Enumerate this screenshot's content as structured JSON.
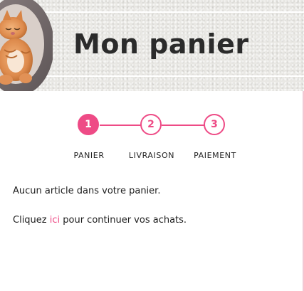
{
  "header": {
    "title": "Mon panier"
  },
  "steps": [
    {
      "number": "1",
      "label": "PANIER",
      "active": true
    },
    {
      "number": "2",
      "label": "LIVRAISON",
      "active": false
    },
    {
      "number": "3",
      "label": "PAIEMENT",
      "active": false
    }
  ],
  "messages": {
    "empty": "Aucun article dans votre panier.",
    "continue_prefix": "Cliquez ",
    "continue_link": "ici",
    "continue_suffix": " pour continuer vos achats."
  },
  "colors": {
    "accent": "#ee4b86",
    "banner_bg": "#e9e8e4",
    "text": "#222222"
  }
}
